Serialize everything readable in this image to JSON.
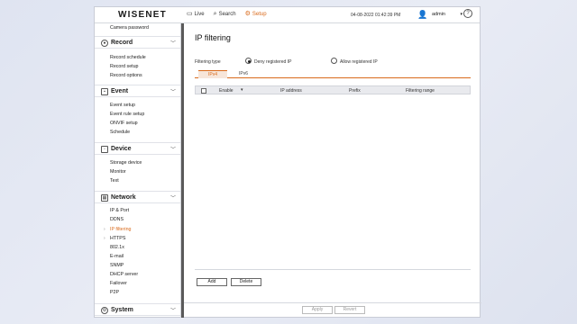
{
  "header": {
    "logo": "WISENET",
    "nav": [
      {
        "label": "Live",
        "icon": "monitor-icon"
      },
      {
        "label": "Search",
        "icon": "search-icon"
      },
      {
        "label": "Setup",
        "icon": "gear-icon"
      }
    ],
    "datetime": "04-08-2022 01:42:39 PM",
    "user": "admin"
  },
  "sidebar": {
    "top_item": "Camera password",
    "record": {
      "label": "Record",
      "items": [
        "Record schedule",
        "Record setup",
        "Record options"
      ]
    },
    "event": {
      "label": "Event",
      "items": [
        "Event setup",
        "Event rule setup",
        "ONVIF setup",
        "Schedule"
      ]
    },
    "device": {
      "label": "Device",
      "items": [
        "Storage device",
        "Monitor",
        "Text"
      ]
    },
    "network": {
      "label": "Network",
      "items": [
        "IP & Port",
        "DDNS",
        "IP filtering",
        "HTTPS",
        "802.1x",
        "E-mail",
        "SNMP",
        "DHCP server",
        "Failover",
        "P2P"
      ]
    },
    "system": {
      "label": "System"
    }
  },
  "main": {
    "title": "IP filtering",
    "filtering_type_label": "Filtering type",
    "option_deny": "Deny registered IP",
    "option_allow": "Allow registered IP",
    "tabs": [
      "IPv4",
      "IPv6"
    ],
    "table_headers": [
      "Enable",
      "IP address",
      "Prefix",
      "Filtering range"
    ],
    "add_label": "Add",
    "delete_label": "Delete",
    "apply_label": "Apply",
    "revert_label": "Revert"
  },
  "colors": {
    "accent": "#d96a1b"
  }
}
